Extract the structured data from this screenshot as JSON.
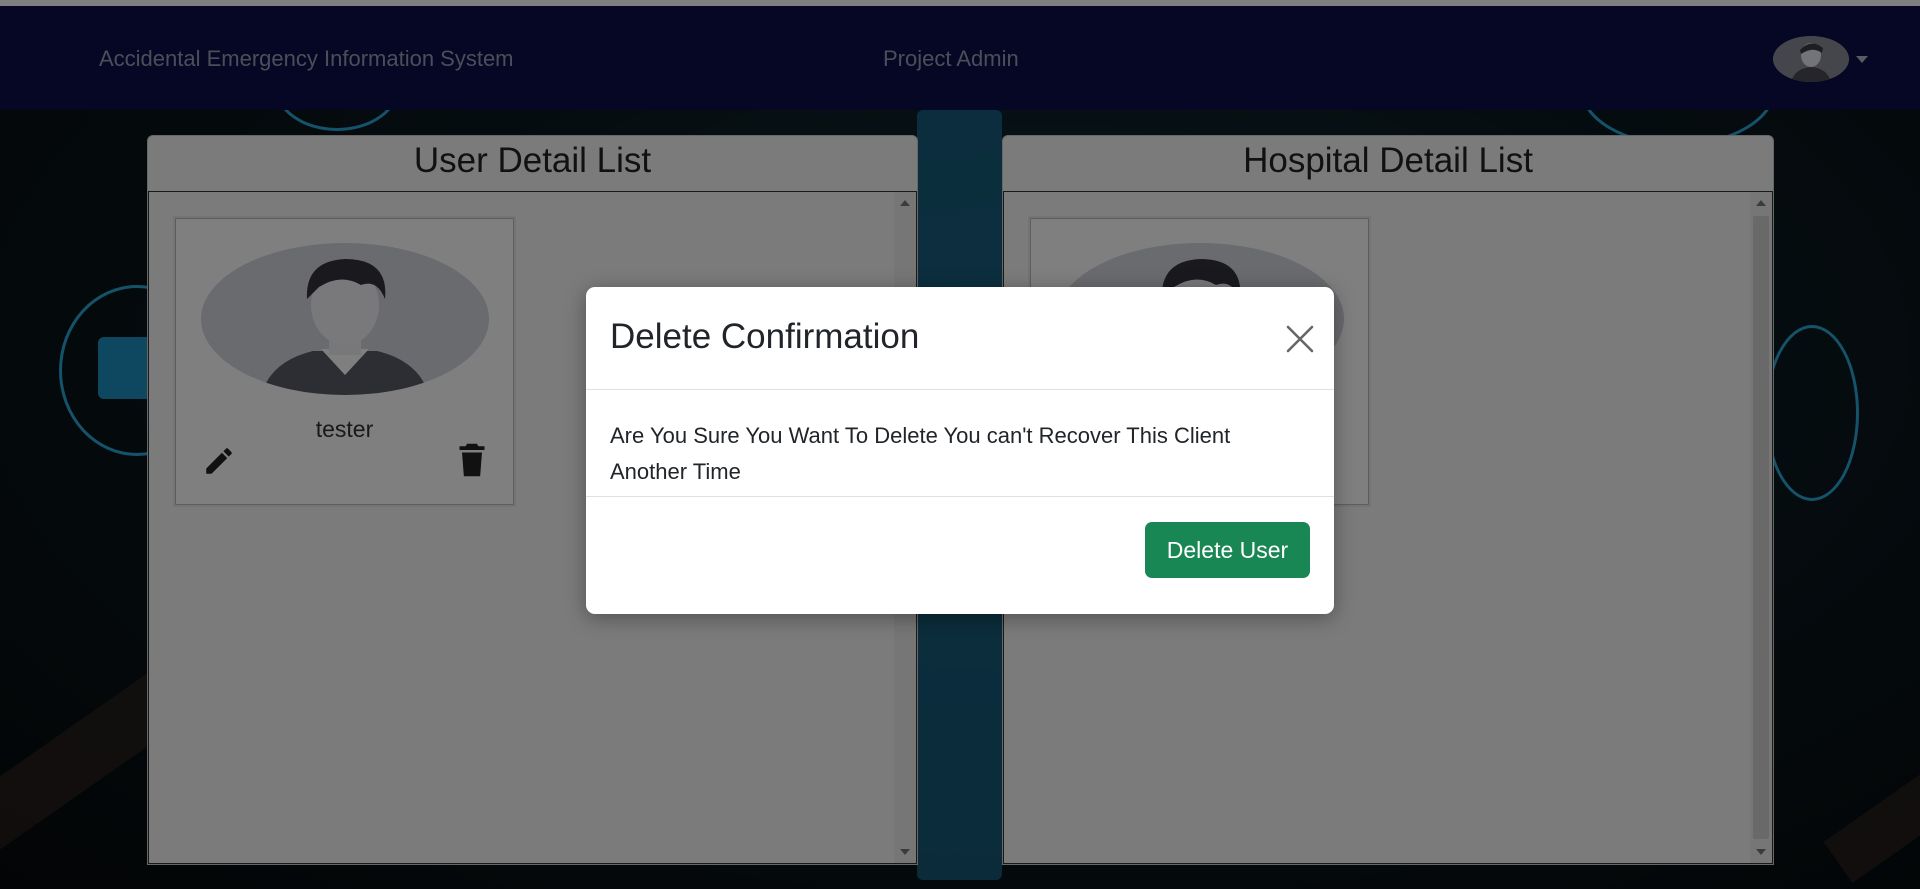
{
  "navbar": {
    "brand": "Accidental Emergency Information System",
    "center_label": "Project Admin"
  },
  "user_panel": {
    "title": "User Detail List",
    "cards": [
      {
        "name": "tester"
      }
    ]
  },
  "hospital_panel": {
    "title": "Hospital Detail List"
  },
  "modal": {
    "title": "Delete Confirmation",
    "message": "Are You Sure You Want To Delete You can't Recover This Client Another Time",
    "confirm_label": "Delete User"
  },
  "colors": {
    "navbar_bg": "#0d0d4a",
    "confirm_button": "#198754",
    "accent_rings": "#2aa6d6"
  },
  "icons": {
    "edit": "pencil-icon",
    "delete": "trash-icon",
    "close": "close-icon",
    "profile": "user-avatar-icon",
    "dropdown": "caret-down-icon"
  }
}
